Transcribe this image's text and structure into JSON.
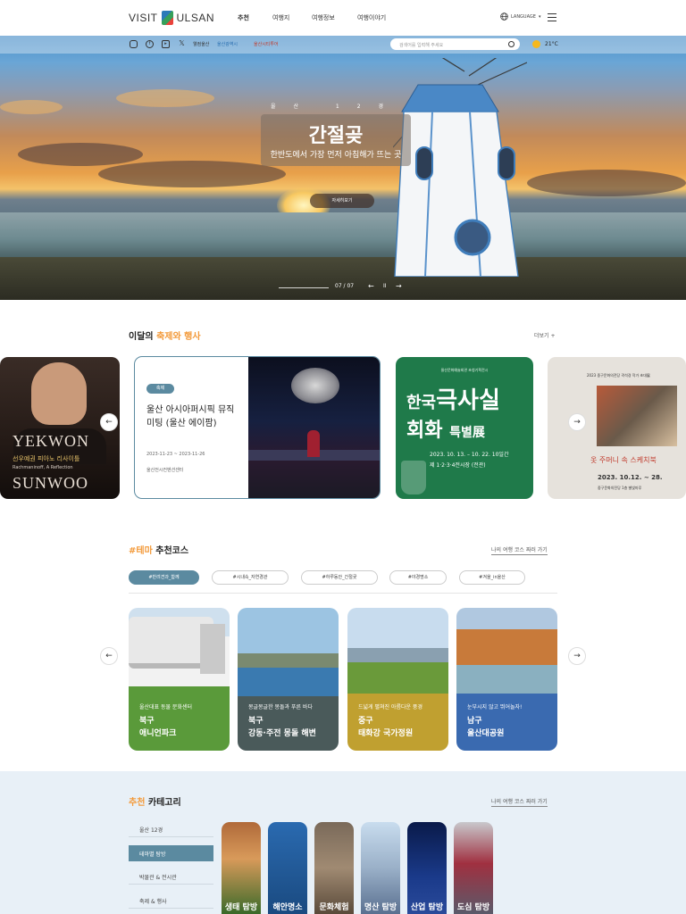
{
  "header": {
    "logo_left": "VISIT",
    "logo_right": "ULSAN",
    "nav": [
      "추천",
      "여행지",
      "여행정보",
      "여행이야기"
    ],
    "language": "LANGUAGE"
  },
  "topbar": {
    "social_icons": [
      "instagram-icon",
      "facebook-icon",
      "youtube-icon",
      "x-icon"
    ],
    "links": [
      "웰컴울산",
      "울산광역시",
      "울산시티투어"
    ],
    "search_placeholder": "검색어를 입력해 주세요",
    "weather": "21°C"
  },
  "hero": {
    "kicker": "울산 12경",
    "title": "간절곶",
    "subtitle": "한반도에서 가장 먼저 아침해가 뜨는 곳",
    "button": "자세히보기",
    "page_current": "07",
    "page_total": "07",
    "pause_label": "II"
  },
  "festival": {
    "title_plain": "이달의 ",
    "title_accent": "축제와 행사",
    "more": "더보기 +",
    "card1": {
      "line1": "YEKWON",
      "line2": "선우예권 피아노 리사이틀",
      "line3": "Rachmaninoff, A Reflection",
      "line4": "SUNWOO"
    },
    "featured": {
      "badge": "축제",
      "title": "울산 아시아퍼시픽 뮤직미팅 (울산 에이팜)",
      "date": "2023-11-23 ~ 2023-11-26",
      "place": "울산전시컨벤션센터"
    },
    "card3": {
      "top": "울산문화예술회관 초청기획전시",
      "title_a": "한국",
      "title_b": "극사실",
      "title_c": "회화",
      "title_d": "특별展",
      "date": "2023. 10. 13. – 10. 22. 10일간",
      "venue": "제 1·2·3·4전시장 (전관)"
    },
    "card4": {
      "top": "2023 중구문화의전당 곽석경 작가 초대展",
      "title": "옷 주머니 속 스케치북",
      "date": "2023. 10.12. ~ 28.",
      "venue": "중구문화의전당 1층 별빛마루"
    }
  },
  "theme": {
    "title_accent": "#테마",
    "title_plain": " 추천코스",
    "more": "나의 여행 코스 짜러 가기",
    "tags": [
      "#반려견과_함께",
      "#시내속_자연경관",
      "#하루동안_간절곶",
      "#야경명소",
      "#겨울_in울산"
    ],
    "courses": [
      {
        "sub": "울산대표 동물 문화센터",
        "area": "북구",
        "name": "애니언파크"
      },
      {
        "sub": "몽글몽글한 몽돌과 푸른 바다",
        "area": "북구",
        "name": "강동·주전 몽돌 해변"
      },
      {
        "sub": "드넓게 펼쳐진 아름다운 풍경",
        "area": "중구",
        "name": "태화강 국가정원"
      },
      {
        "sub": "눈부시지 않고 뛰어놀자!",
        "area": "남구",
        "name": "울산대공원"
      }
    ]
  },
  "category": {
    "title_accent": "추천",
    "title_plain": " 카테고리",
    "more": "나의 여행 코스 짜러 가기",
    "menu": [
      "울산 12경",
      "테마별 탐방",
      "박물관 & 전시관",
      "축제 & 행사"
    ],
    "tiles": [
      "생태 탐방",
      "해안명소",
      "문화체험",
      "명산 탐방",
      "산업 탐방",
      "도심 탐방"
    ]
  },
  "colors": {
    "accent": "#f39a3a",
    "primary": "#5b8aa0",
    "category_bg": "#e8f0f7"
  }
}
